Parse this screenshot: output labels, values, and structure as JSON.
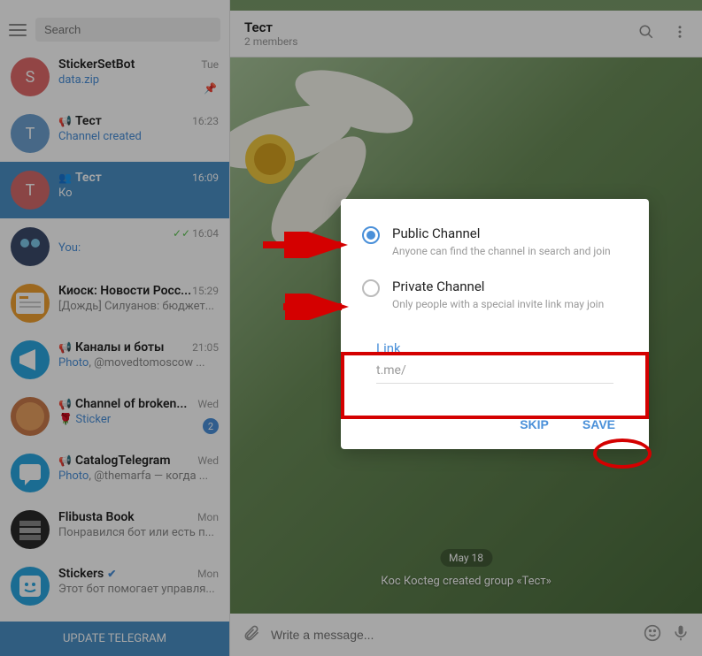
{
  "search_placeholder": "Search",
  "header": {
    "title": "Тест",
    "sub": "2 members"
  },
  "chats": [
    {
      "name": "StickerSetBot",
      "preview_html": "<span class='link'>data.zip</span>",
      "time": "Tue",
      "pinned": true,
      "avatar_bg": "#e06b6b",
      "avatar_text": "S"
    },
    {
      "name": "Тест",
      "preview_html": "<span class='link'>Channel created</span>",
      "time": "16:23",
      "megaphone": true,
      "avatar_bg": "#6ea0cf",
      "avatar_text": "T"
    },
    {
      "name": "Тест",
      "preview_html": "Ко",
      "time": "16:09",
      "people": true,
      "active": true,
      "avatar_bg": "#d46a6a",
      "avatar_text": "T"
    },
    {
      "name": "",
      "preview_html": "<span class='you'>You:</span> ",
      "time": "16:04",
      "checks": true,
      "avatar_bg": "#3b4a6b",
      "avatar_img": "bot"
    },
    {
      "name": "Киоск: Новости Росс...",
      "preview_html": "[Дождь]  Силуанов: бюджет...",
      "time": "15:29",
      "avatar_bg": "#f0a030",
      "avatar_img": "news"
    },
    {
      "name": "Каналы и боты",
      "preview_html": "<span class='link'>Photo</span>, @movedtomoscow ...",
      "time": "21:05",
      "megaphone": true,
      "avatar_bg": "#2aa7e0",
      "avatar_img": "mega"
    },
    {
      "name": "Channel of broken...",
      "preview_html": "🌹 <span class='link'>Sticker</span>",
      "time": "Wed",
      "megaphone": true,
      "badge": "2",
      "avatar_bg": "#c97a4a",
      "avatar_img": "shrimp"
    },
    {
      "name": "CatalogTelegram",
      "preview_html": "<span class='link'>Photo</span>, @themarfa — когда ...",
      "time": "Wed",
      "megaphone": true,
      "avatar_bg": "#2aa7e0",
      "avatar_img": "msg"
    },
    {
      "name": "Flibusta Book",
      "preview_html": "Понравился бот или есть п...",
      "time": "Mon",
      "avatar_bg": "#2a2a2a",
      "avatar_img": "books"
    },
    {
      "name": "Stickers",
      "preview_html": "Этот бот помогает управля...",
      "time": "Mon",
      "verified": true,
      "avatar_bg": "#2aa7e0",
      "avatar_img": "sticker"
    }
  ],
  "update_label": "UPDATE TELEGRAM",
  "date_chip": "May 18",
  "system_msg": "Кос Косteg created group «Тест»",
  "composer_placeholder": "Write a message...",
  "dialog": {
    "opt1_title": "Public Channel",
    "opt1_desc": "Anyone can find the channel in search and join",
    "opt2_title": "Private Channel",
    "opt2_desc": "Only people with a special invite link may join",
    "link_label": "Link",
    "link_value": "t.me/",
    "skip": "SKIP",
    "save": "SAVE"
  }
}
